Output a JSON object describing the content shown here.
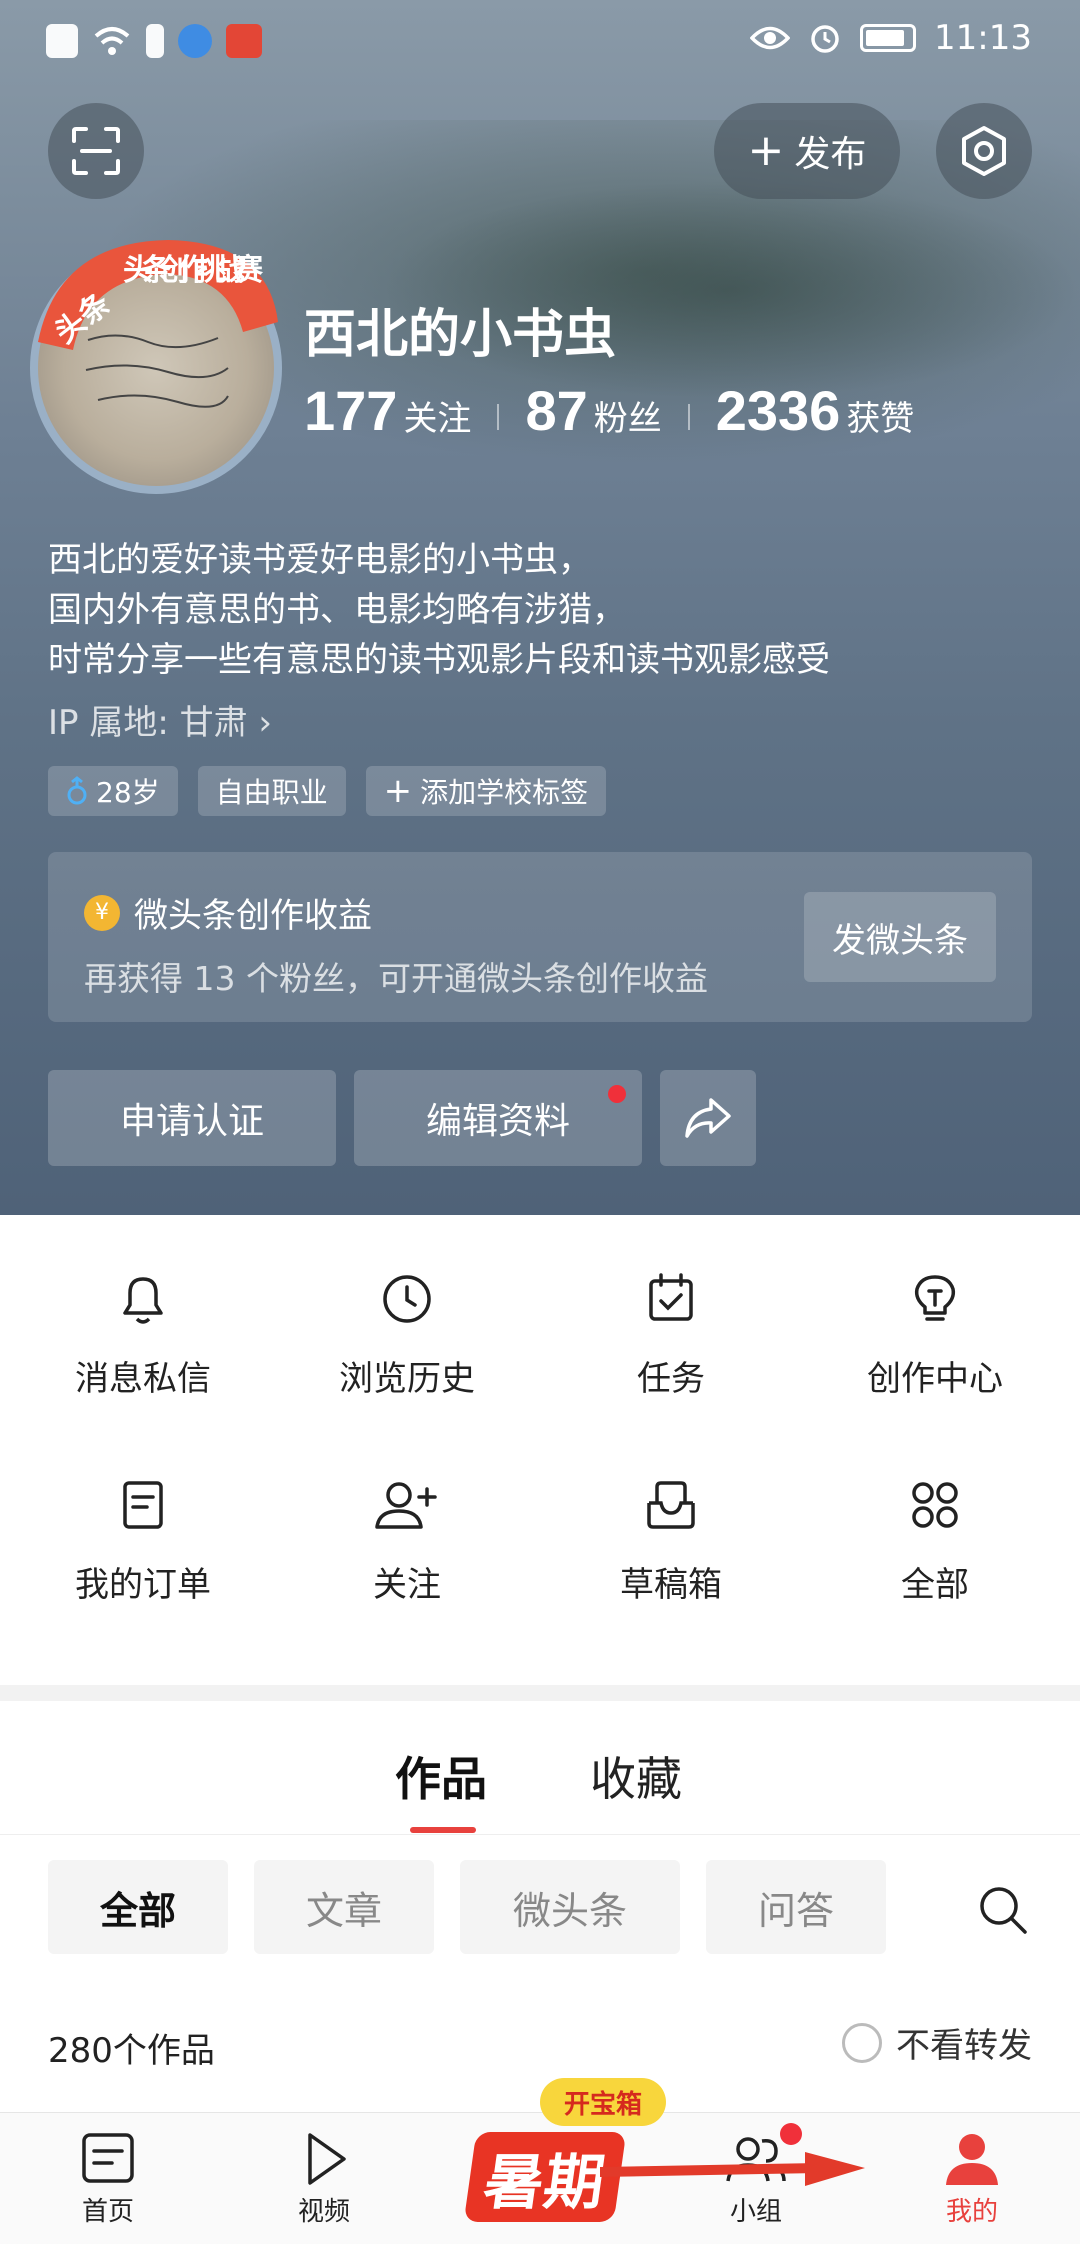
{
  "status_bar": {
    "time": "11:13"
  },
  "header": {
    "publish_label": "发布"
  },
  "profile": {
    "badge_text": "头条创作挑战赛",
    "nickname": "西北的小书虫",
    "stats": [
      {
        "num": "177",
        "label": "关注"
      },
      {
        "num": "87",
        "label": "粉丝"
      },
      {
        "num": "2336",
        "label": "获赞"
      }
    ],
    "bio": [
      "西北的爱好读书爱好电影的小书虫，",
      "国内外有意思的书、电影均略有涉猎，",
      "时常分享一些有意思的读书观影片段和读书观影感受"
    ],
    "ip": "IP 属地: 甘肃",
    "tags": {
      "age": "28岁",
      "job": "自由职业",
      "school": "添加学校标签"
    }
  },
  "income": {
    "coin": "¥",
    "title": "微头条创作收益",
    "desc": "再获得 13 个粉丝，可开通微头条创作收益",
    "button": "发微头条"
  },
  "actions": {
    "verify": "申请认证",
    "edit": "编辑资料"
  },
  "features": [
    {
      "label": "消息私信",
      "icon": "bell-icon"
    },
    {
      "label": "浏览历史",
      "icon": "clock-icon"
    },
    {
      "label": "任务",
      "icon": "calendar-check-icon"
    },
    {
      "label": "创作中心",
      "icon": "bulb-icon"
    },
    {
      "label": "我的订单",
      "icon": "order-icon"
    },
    {
      "label": "关注",
      "icon": "add-user-icon"
    },
    {
      "label": "草稿箱",
      "icon": "inbox-icon"
    },
    {
      "label": "全部",
      "icon": "apps-icon"
    }
  ],
  "content_tabs": {
    "works": "作品",
    "favorites": "收藏"
  },
  "filters": [
    "全部",
    "文章",
    "微头条",
    "问答"
  ],
  "works_count": "280个作品",
  "no_repost": "不看转发",
  "bottom_nav": {
    "home": "首页",
    "video": "视频",
    "promo_chip": "开宝箱",
    "promo_text": "暑期",
    "group": "小组",
    "mine": "我的"
  },
  "colors": {
    "accent": "#e8413d",
    "coin": "#f3b632"
  }
}
